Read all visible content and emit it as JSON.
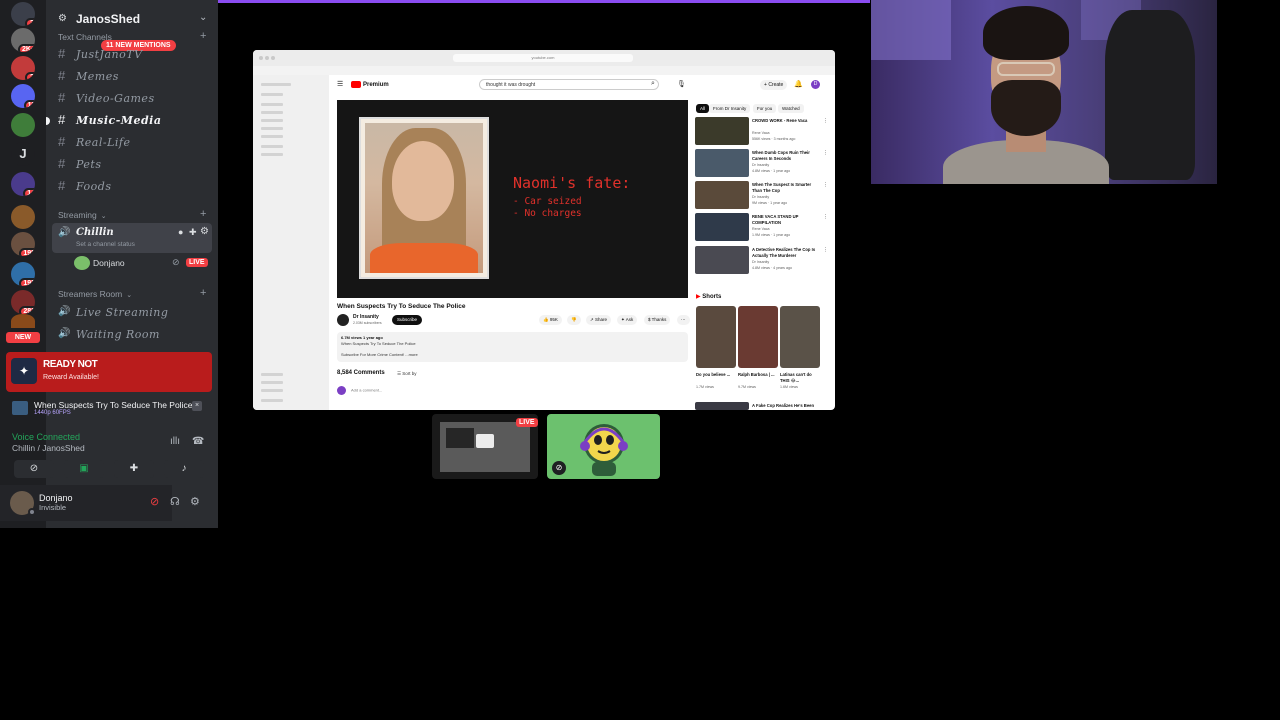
{
  "server_rail": {
    "badges": [
      "3",
      "2K+",
      "2",
      "11",
      "14",
      "198",
      "193",
      "282"
    ],
    "letter_server": "J",
    "new_label": "NEW"
  },
  "guild": {
    "name": "JanosShed",
    "mention_pill": "11 NEW MENTIONS"
  },
  "categories": {
    "text": "Text Channels",
    "streaming": "Streaming",
    "streamers_room": "Streamers Room"
  },
  "text_channels": [
    {
      "name": "JustJanoTV"
    },
    {
      "name": "Memes"
    },
    {
      "name": "Video-Games"
    },
    {
      "name": "Music-Media"
    },
    {
      "name": "Real-Life"
    },
    {
      "name": "Pets"
    },
    {
      "name": "Foods"
    }
  ],
  "voice_channel": {
    "name": "Chillin",
    "status_placeholder": "Set a channel status",
    "member": "Donjano",
    "live": "LIVE"
  },
  "streamers_channels": [
    {
      "name": "Live Streaming"
    },
    {
      "name": "Waiting Room"
    }
  ],
  "promo": {
    "title": "READY NOT",
    "subtitle": "Reward Available!"
  },
  "stream_panel": {
    "title": "When Suspects Try To Seduce The Police ...",
    "quality": "1440p 60FPS"
  },
  "voice_connection": {
    "status": "Voice Connected",
    "channel": "Chillin / JanosShed"
  },
  "user": {
    "name": "Donjano",
    "status": "Invisible"
  },
  "browser": {
    "url": "youtube.com",
    "logo": "Premium",
    "search_value": "thought it was drought",
    "create_label": "Create",
    "avatar_letter": "D"
  },
  "video": {
    "overlay_heading": "Naomi's fate:",
    "overlay_lines": [
      "- Car seized",
      "- No charges"
    ],
    "title": "When Suspects Try To Seduce The Police",
    "channel": "Dr Insanity",
    "subscribers": "2.03M subscribers",
    "subscribe_label": "Subscribe",
    "likes": "95K",
    "share_label": "Share",
    "ask_label": "Ask",
    "thanks_label": "Thanks",
    "views_meta": "6.7M views  1 year ago",
    "desc_line1": "When Suspects Try To Seduce The Police",
    "desc_line2": "Subscribe For More Crime Content! ...more",
    "comments_count": "8,584 Comments",
    "sort_label": "Sort by",
    "add_comment": "Add a comment..."
  },
  "chips": [
    "All",
    "From Dr Insanity",
    "For you",
    "Watched"
  ],
  "recommendations": [
    {
      "title": "CROWD WORK - Rene Vaca",
      "channel": "Rene Vaca",
      "meta": "556K views · 3 months ago",
      "color": "#3b3a2a"
    },
    {
      "title": "When Dumb Cops Ruin Their Careers In Seconds",
      "channel": "Dr Insanity",
      "meta": "4.8M views · 1 year ago",
      "color": "#4a5a6a"
    },
    {
      "title": "When The Suspect Is Smarter Than The Cop",
      "channel": "Dr Insanity",
      "meta": "9M views · 1 year ago",
      "color": "#5a4a3a"
    },
    {
      "title": "RENE VACA STAND UP COMPILATION",
      "channel": "Rene Vaca",
      "meta": "1.9M views · 1 year ago",
      "color": "#2f3a4a"
    },
    {
      "title": "A Detective Realizes The Cop Is Actually The Murderer",
      "channel": "Dr Insanity",
      "meta": "4.8M views · 4 years ago",
      "color": "#4a4a52"
    }
  ],
  "shorts": {
    "heading": "Shorts",
    "items": [
      {
        "title": "Do you believe ...",
        "views": "1.7M views",
        "color": "#5a4a3e"
      },
      {
        "title": "Ralph Barbosa | ...",
        "views": "9.7M views",
        "color": "#6a3a32"
      },
      {
        "title": "Latinas can't do THIS 😂...",
        "views": "1.6M views",
        "color": "#5a5248"
      }
    ]
  },
  "bottom_rec": {
    "title": "A Fake Cop Realizes He's Been"
  },
  "tiles": {
    "live": "LIVE"
  },
  "colors": {
    "accent": "#8a4cf0",
    "live_red": "#f23f43",
    "connected_green": "#23a55a",
    "yt_red": "#ff0000"
  }
}
